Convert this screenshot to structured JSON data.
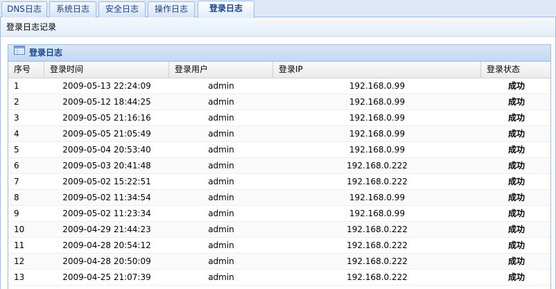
{
  "tabs": [
    {
      "label": "DNS日志",
      "active": false
    },
    {
      "label": "系统日志",
      "active": false
    },
    {
      "label": "安全日志",
      "active": false
    },
    {
      "label": "操作日志",
      "active": false
    },
    {
      "label": "登录日志",
      "active": true
    }
  ],
  "toolbar": {
    "title": "登录日志记录"
  },
  "panel": {
    "title": "登录日志"
  },
  "table": {
    "columns": [
      "序号",
      "登录时间",
      "登录用户",
      "登录IP",
      "登录状态"
    ],
    "rows": [
      {
        "no": "1",
        "time": "2009-05-13 22:24:09",
        "user": "admin",
        "ip": "192.168.0.99",
        "status": "成功"
      },
      {
        "no": "2",
        "time": "2009-05-12 18:44:25",
        "user": "admin",
        "ip": "192.168.0.99",
        "status": "成功"
      },
      {
        "no": "3",
        "time": "2009-05-05 21:16:16",
        "user": "admin",
        "ip": "192.168.0.99",
        "status": "成功"
      },
      {
        "no": "4",
        "time": "2009-05-05 21:05:49",
        "user": "admin",
        "ip": "192.168.0.99",
        "status": "成功"
      },
      {
        "no": "5",
        "time": "2009-05-04 20:53:40",
        "user": "admin",
        "ip": "192.168.0.99",
        "status": "成功"
      },
      {
        "no": "6",
        "time": "2009-05-03 20:41:48",
        "user": "admin",
        "ip": "192.168.0.222",
        "status": "成功"
      },
      {
        "no": "7",
        "time": "2009-05-02 15:22:51",
        "user": "admin",
        "ip": "192.168.0.222",
        "status": "成功"
      },
      {
        "no": "8",
        "time": "2009-05-02 11:34:54",
        "user": "admin",
        "ip": "192.168.0.99",
        "status": "成功"
      },
      {
        "no": "9",
        "time": "2009-05-02 11:23:34",
        "user": "admin",
        "ip": "192.168.0.99",
        "status": "成功"
      },
      {
        "no": "10",
        "time": "2009-04-29 21:44:23",
        "user": "admin",
        "ip": "192.168.0.222",
        "status": "成功"
      },
      {
        "no": "11",
        "time": "2009-04-28 20:54:12",
        "user": "admin",
        "ip": "192.168.0.222",
        "status": "成功"
      },
      {
        "no": "12",
        "time": "2009-04-28 20:50:09",
        "user": "admin",
        "ip": "192.168.0.222",
        "status": "成功"
      },
      {
        "no": "13",
        "time": "2009-04-25 21:07:39",
        "user": "admin",
        "ip": "192.168.0.222",
        "status": "成功"
      }
    ]
  },
  "colors": {
    "accent": "#15428b",
    "border": "#99bbe8",
    "background": "#dfe8f6"
  }
}
